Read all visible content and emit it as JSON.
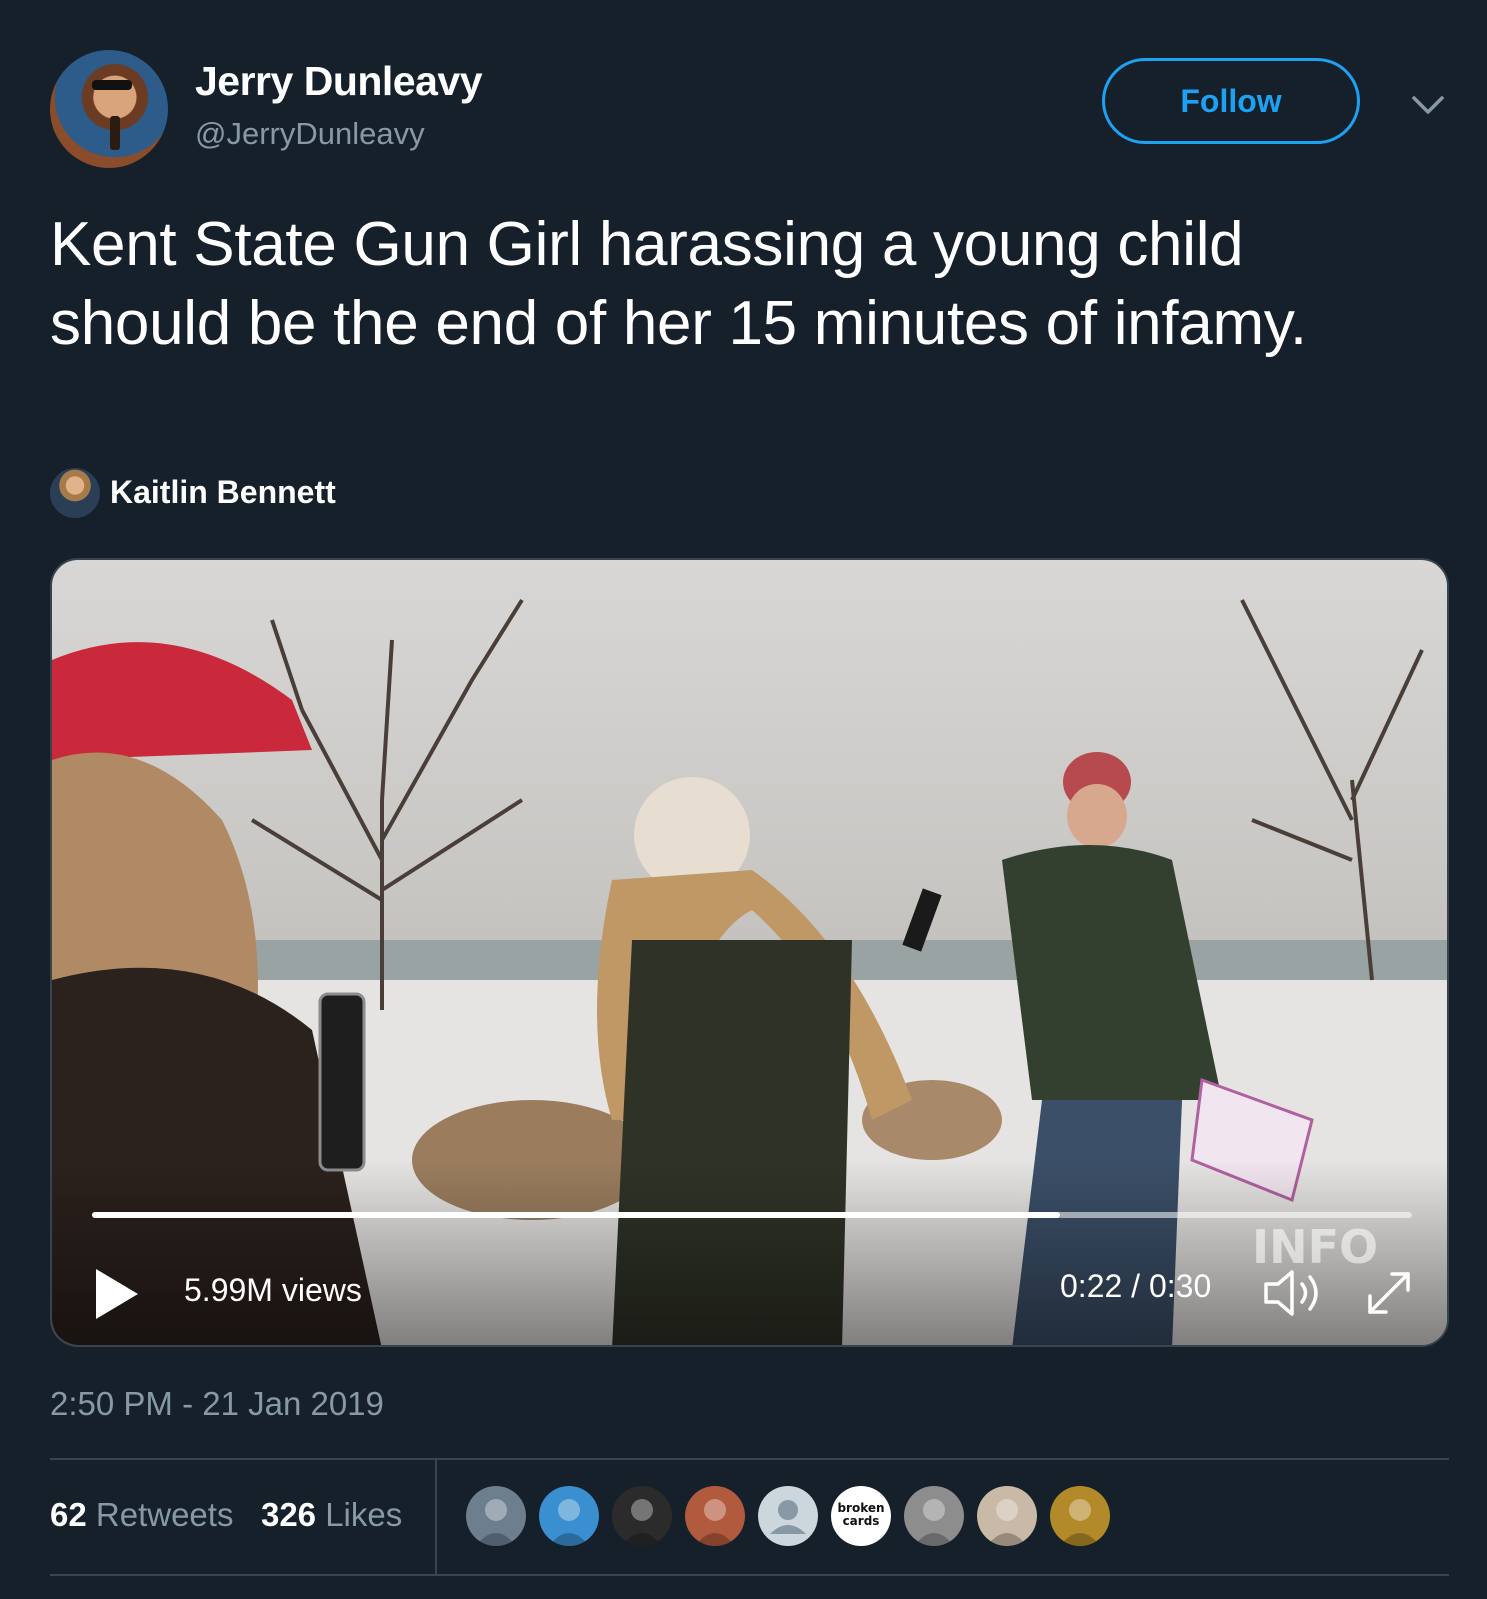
{
  "author": {
    "name": "Jerry Dunleavy",
    "handle": "@JerryDunleavy",
    "avatar_icon": "profile-photo"
  },
  "follow_label": "Follow",
  "menu_icon": "chevron-down-icon",
  "tweet": {
    "text": "Kent State Gun Girl harassing a young child should be the end of her 15 minutes of infamy."
  },
  "attribution": {
    "name": "Kaitlin Bennett"
  },
  "video": {
    "views": "5.99M views",
    "time": "0:22 / 0:30",
    "progress": 0.733,
    "watermark": "INFO"
  },
  "timestamp": "2:50 PM - 21 Jan 2019",
  "stats": {
    "retweets_count": "62",
    "retweets_label": "Retweets",
    "likes_count": "326",
    "likes_label": "Likes"
  },
  "likers": [
    {
      "icon": "liker-avatar-1",
      "color": "#6d7e8f"
    },
    {
      "icon": "liker-avatar-2",
      "color": "#3a8fd0"
    },
    {
      "icon": "liker-avatar-3",
      "color": "#2b2b2b"
    },
    {
      "icon": "liker-avatar-4",
      "color": "#b25a3d"
    },
    {
      "icon": "default-profile-icon",
      "color": "#ccd6dd"
    },
    {
      "icon": "liker-avatar-broken-cards",
      "color": "#ffffff",
      "text": "broken cards"
    },
    {
      "icon": "liker-avatar-7",
      "color": "#8d8d8d"
    },
    {
      "icon": "liker-avatar-8",
      "color": "#c9b9a7"
    },
    {
      "icon": "liker-avatar-9",
      "color": "#b38a2a"
    }
  ],
  "colors": {
    "background": "#15202b",
    "accent": "#1da1f2",
    "secondary_text": "#8899a6",
    "border": "#38444d"
  }
}
